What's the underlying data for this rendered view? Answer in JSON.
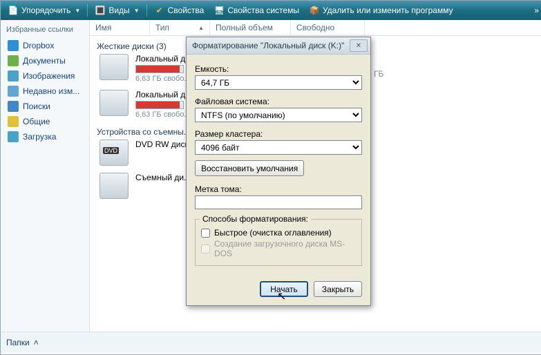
{
  "toolbar": {
    "organize": "Упорядочить",
    "views": "Виды",
    "properties": "Свойства",
    "sys_properties": "Свойства системы",
    "uninstall": "Удалить или изменить программу"
  },
  "sidebar": {
    "header": "Избранные ссылки",
    "items": [
      {
        "label": "Dropbox",
        "color": "#2f8fd6"
      },
      {
        "label": "Документы",
        "color": "#6fb04a"
      },
      {
        "label": "Изображения",
        "color": "#4aa3c7"
      },
      {
        "label": "Недавно изм...",
        "color": "#5fa8d6"
      },
      {
        "label": "Поиски",
        "color": "#3f87c7"
      },
      {
        "label": "Общие",
        "color": "#e0c23a"
      },
      {
        "label": "Загрузка",
        "color": "#4aa3c7"
      }
    ]
  },
  "columns": {
    "name": "Имя",
    "type": "Тип",
    "total": "Полный объем",
    "free": "Свободно"
  },
  "groups": {
    "hdd": {
      "title": "Жесткие диски (3)",
      "items": [
        {
          "name": "Локальный д...",
          "free_text": "6,63 ГБ свобо...",
          "fill": 92
        },
        {
          "name": "Локальный д...",
          "free_text": "6,63 ГБ свобо...",
          "fill": 92
        }
      ]
    },
    "removable": {
      "title": "Устройства со съемны...",
      "items": [
        {
          "name": "DVD RW диск..."
        },
        {
          "name": "Съемный ди..."
        }
      ]
    }
  },
  "stray_gb": "ГБ",
  "footer": {
    "label": "Папки"
  },
  "dialog": {
    "title": "Форматирование \"Локальный диск (K:)\"",
    "capacity_label": "Емкость:",
    "capacity_value": "64,7 ГБ",
    "fs_label": "Файловая система:",
    "fs_value": "NTFS (по умолчанию)",
    "cluster_label": "Размер кластера:",
    "cluster_value": "4096 байт",
    "restore": "Восстановить умолчания",
    "volume_label": "Метка тома:",
    "volume_value": "",
    "methods_title": "Способы форматирования:",
    "quick": "Быстрое (очистка оглавления)",
    "msdos": "Создание загрузочного диска MS-DOS",
    "start": "Начать",
    "close": "Закрыть"
  }
}
